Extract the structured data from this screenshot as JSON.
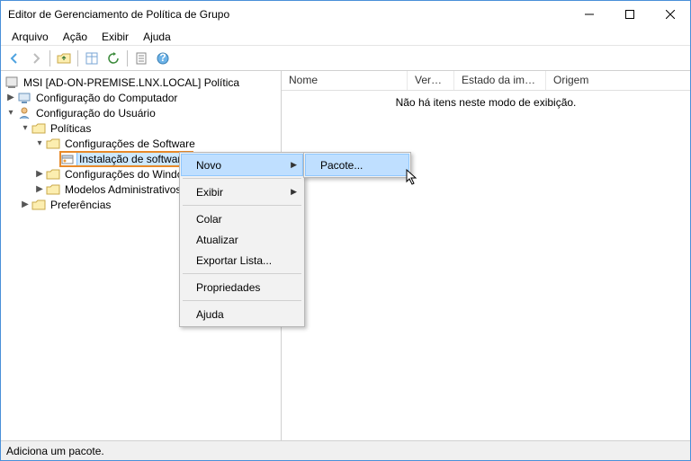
{
  "window": {
    "title": "Editor de Gerenciamento de Política de Grupo"
  },
  "menu": {
    "arquivo": "Arquivo",
    "acao": "Ação",
    "exibir": "Exibir",
    "ajuda": "Ajuda"
  },
  "tree": {
    "root": "MSI [AD-ON-PREMISE.LNX.LOCAL] Política",
    "computador": "Configuração do Computador",
    "usuario": "Configuração do Usuário",
    "politicas": "Políticas",
    "conf_software": "Configurações de Software",
    "instalacao": "Instalação de software",
    "conf_windows": "Configurações do Windows",
    "modelos": "Modelos Administrativos",
    "preferencias": "Preferências"
  },
  "columns": {
    "nome": "Nome",
    "versao": "Versão",
    "estado": "Estado da impl...",
    "origem": "Origem"
  },
  "list": {
    "empty": "Não há itens neste modo de exibição."
  },
  "context": {
    "novo": "Novo",
    "exibir": "Exibir",
    "colar": "Colar",
    "atualizar": "Atualizar",
    "exportar": "Exportar Lista...",
    "propriedades": "Propriedades",
    "ajuda": "Ajuda",
    "pacote": "Pacote..."
  },
  "status": {
    "text": "Adiciona um pacote."
  },
  "icons": {
    "back": "back-icon",
    "forward": "forward-icon",
    "up": "up-folder-icon",
    "vsep": "separator",
    "list": "list-icon",
    "help": "help-icon",
    "refresh": "refresh-icon",
    "props": "properties-icon"
  }
}
